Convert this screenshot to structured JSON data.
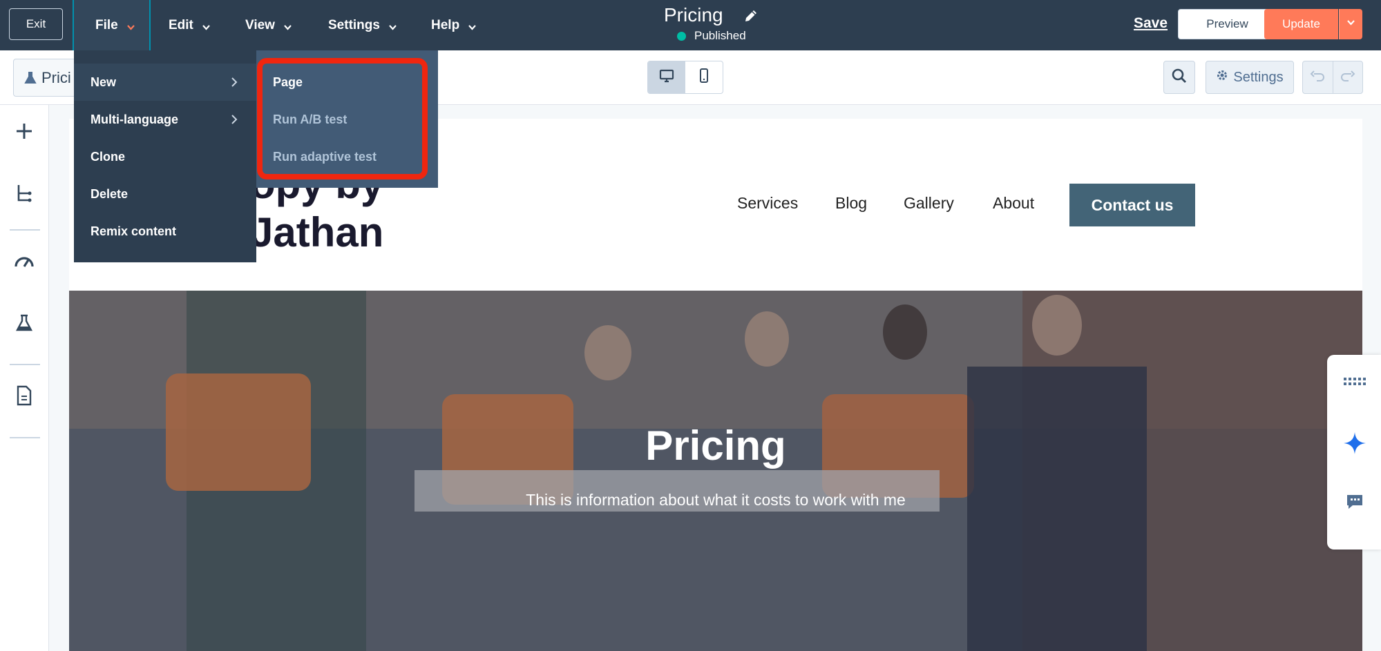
{
  "topbar": {
    "exit_label": "Exit",
    "menus": [
      {
        "label": "File"
      },
      {
        "label": "Edit"
      },
      {
        "label": "View"
      },
      {
        "label": "Settings"
      },
      {
        "label": "Help"
      }
    ],
    "page_title": "Pricing",
    "status": "Published",
    "save_label": "Save",
    "preview_label": "Preview",
    "update_label": "Update"
  },
  "toolbar": {
    "test_chip_label": "Prici",
    "settings_label": "Settings"
  },
  "file_menu": {
    "items": [
      {
        "label": "New"
      },
      {
        "label": "Multi-language"
      },
      {
        "label": "Clone"
      },
      {
        "label": "Delete"
      },
      {
        "label": "Remix content"
      }
    ],
    "submenu": [
      {
        "label": "Page"
      },
      {
        "label": "Run A/B test"
      },
      {
        "label": "Run adaptive test"
      }
    ]
  },
  "site": {
    "logo_lines": [
      "opy by",
      "Jathan"
    ],
    "nav": [
      "Services",
      "Blog",
      "Gallery",
      "About"
    ],
    "contact_label": "Contact us",
    "hero_title": "Pricing",
    "hero_subtitle": "This is information about what it costs to work with me"
  },
  "colors": {
    "topbar": "#2d3e50",
    "accent_orange": "#ff7a59",
    "highlight_red": "#f0260f",
    "published_dot": "#00bda5",
    "contact_button": "#436477"
  }
}
